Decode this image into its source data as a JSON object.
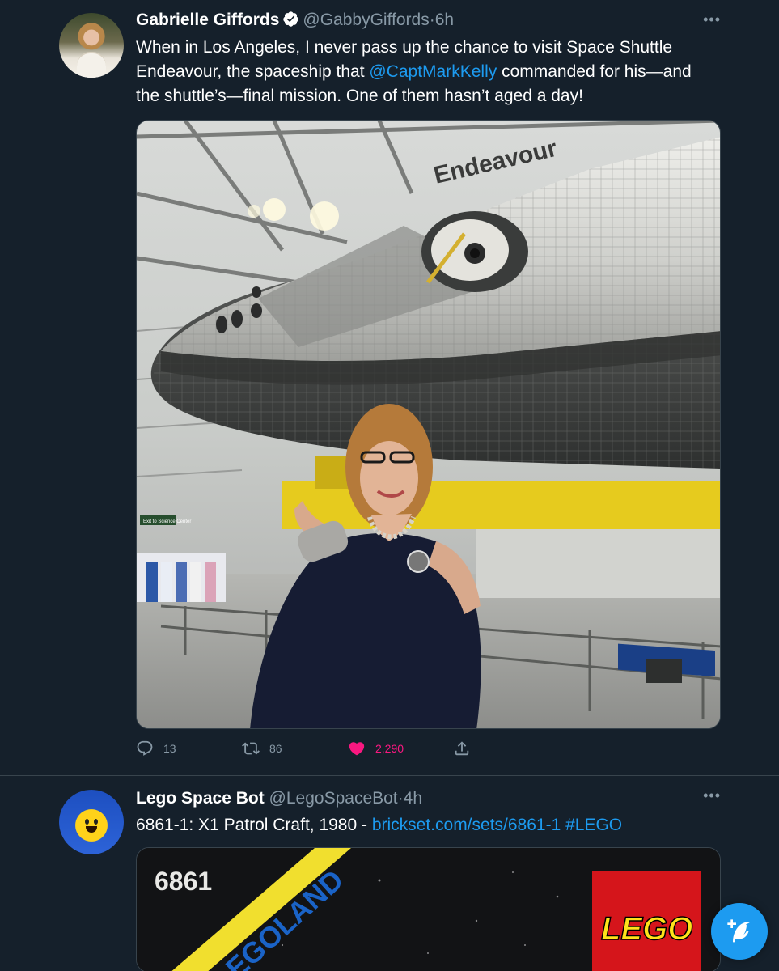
{
  "timeline": {
    "tweets": [
      {
        "author_name": "Gabrielle Giffords",
        "handle": "@GabbyGiffords",
        "separator": "·",
        "time": "6h",
        "verified": true,
        "text_before": "When in Los Angeles, I never pass up the chance to visit Space Shuttle Endeavour, the spaceship that ",
        "mention": "@CaptMarkKelly",
        "text_after": " commanded for his—and the shuttle’s—final mission. One of them hasn’t aged a day!",
        "media": {
          "shuttle_name": "Endeavour",
          "sign_text": "Exit to Science Center"
        },
        "replies": "13",
        "retweets": "86",
        "likes": "2,290",
        "liked": true
      },
      {
        "author_name": "Lego Space Bot",
        "handle": "@LegoSpaceBot",
        "separator": "·",
        "time": "4h",
        "text_before": "6861-1: X1 Patrol Craft, 1980 - ",
        "link": "brickset.com/sets/6861-1",
        "hashtag": "#LEGO",
        "media": {
          "set_number": "6861",
          "banner_text": "LEGOLAND",
          "logo_text": "LEGO"
        }
      }
    ]
  },
  "more_icon": "•••",
  "colors": {
    "background": "#15202b",
    "accent": "#1d9bf0",
    "like": "#f91880",
    "muted": "#8899a6"
  },
  "icons": [
    "verified-badge-icon",
    "more-icon",
    "reply-icon",
    "retweet-icon",
    "heart-icon",
    "share-icon",
    "compose-tweet-icon"
  ]
}
